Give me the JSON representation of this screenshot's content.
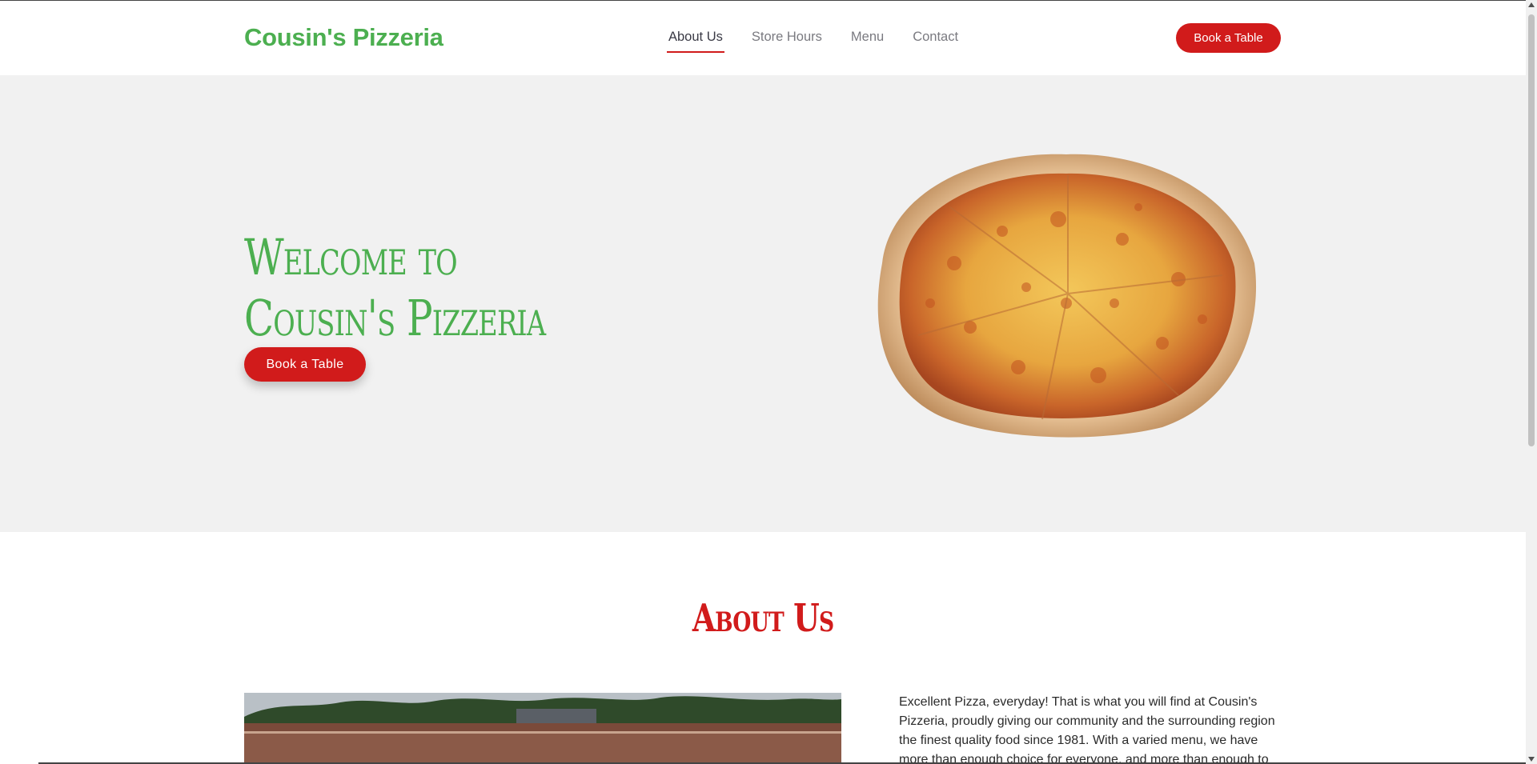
{
  "header": {
    "brand": "Cousin's Pizzeria",
    "nav": [
      {
        "label": "About Us",
        "active": true
      },
      {
        "label": "Store Hours",
        "active": false
      },
      {
        "label": "Menu",
        "active": false
      },
      {
        "label": "Contact",
        "active": false
      }
    ],
    "cta_label": "Book a Table"
  },
  "hero": {
    "title_line1": "Welcome to",
    "title_line2": "Cousin's Pizzeria",
    "cta_label": "Book a Table",
    "image_icon": "pizza-image"
  },
  "about": {
    "title": "About Us",
    "image_icon": "storefront-photo",
    "text": "Excellent Pizza, everyday! That is what you will find at Cousin's Pizzeria, proudly giving our community and the surrounding region the finest quality food since 1981. With a varied menu, we have more than enough choice for everyone, and more than enough to"
  },
  "colors": {
    "brand_green": "#4caf50",
    "accent_red": "#d11b1b",
    "hero_bg": "#f1f1f1"
  }
}
